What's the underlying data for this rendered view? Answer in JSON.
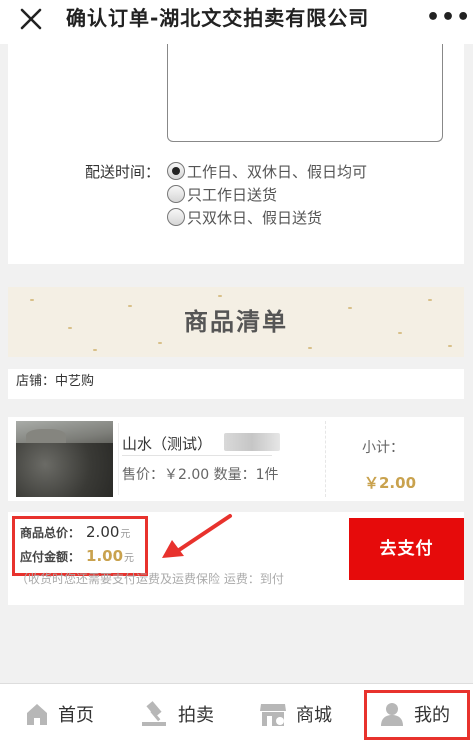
{
  "titlebar": {
    "title": "确认订单-湖北文交拍卖有限公司",
    "more": "•••"
  },
  "delivery": {
    "label": "配送时间：",
    "options": [
      {
        "label": "工作日、双休日、假日均可",
        "selected": true
      },
      {
        "label": "只工作日送货",
        "selected": false
      },
      {
        "label": "只双休日、假日送货",
        "selected": false
      }
    ]
  },
  "product_list": {
    "heading": "商品清单"
  },
  "store": {
    "text": "店铺：中艺购"
  },
  "product": {
    "name": "山水（测试）",
    "price_line": "售价：￥2.00 数量：1件",
    "subtotal_label": "小计：",
    "subtotal_value": "￥2.00"
  },
  "summary": {
    "total_label": "商品总价：",
    "total_value": "2.00",
    "pay_label": "应付金额：",
    "pay_value": "1.00",
    "unit": "元",
    "note": "（收货时您还需要支付运费及运费保险 运费：到付",
    "pay_button": "去支付"
  },
  "bottom_nav": {
    "items": [
      {
        "label": "首页",
        "icon": "home-icon"
      },
      {
        "label": "拍卖",
        "icon": "gavel-icon"
      },
      {
        "label": "商城",
        "icon": "store-icon"
      },
      {
        "label": "我的",
        "icon": "user-icon",
        "active": true
      }
    ]
  },
  "colors": {
    "accent_red": "#e60b0b",
    "highlight_red": "#e8322d",
    "price_gold": "#c9a24e"
  }
}
